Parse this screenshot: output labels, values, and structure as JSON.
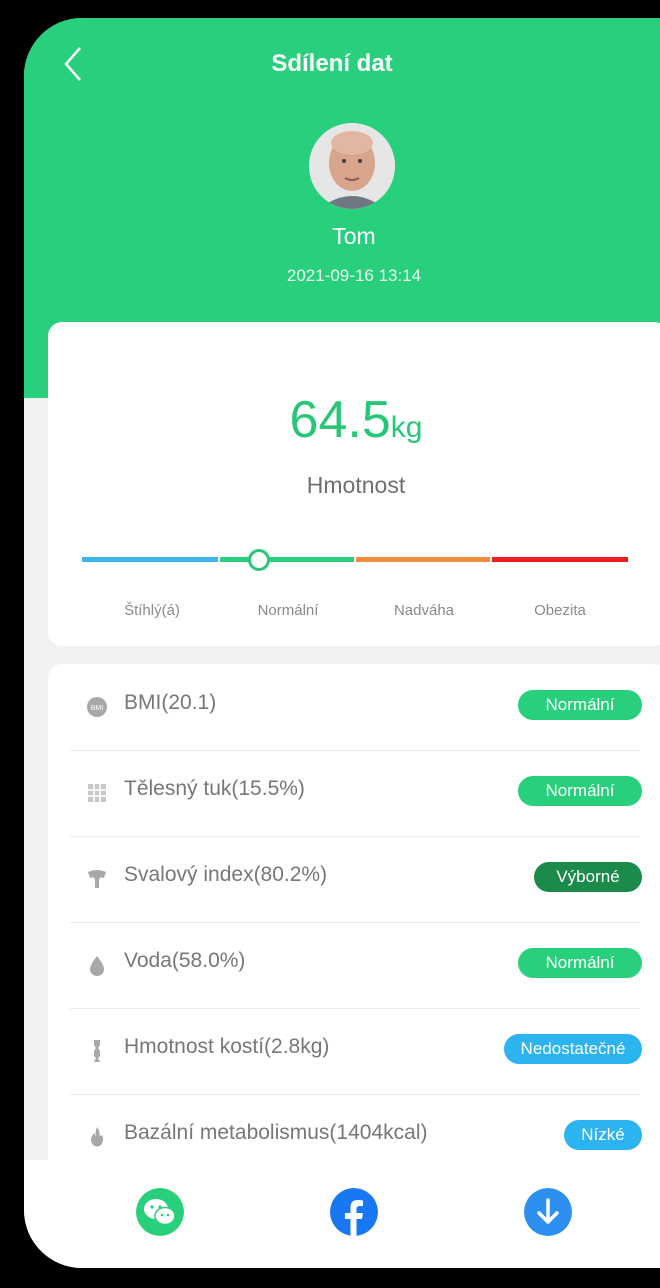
{
  "header": {
    "title": "Sdílení dat",
    "username": "Tom",
    "datetime": "2021-09-16 13:14"
  },
  "weight": {
    "value": "64.5",
    "unit": "kg",
    "label": "Hmotnost"
  },
  "scale": {
    "labels": [
      "Štíhlý(á)",
      "Normální",
      "Nadváha",
      "Obezita"
    ],
    "colors": [
      "#3db4ea",
      "#28cf7c",
      "#f0903c",
      "#ea2020"
    ]
  },
  "metrics": [
    {
      "label": "BMI(20.1)",
      "status": "Normální",
      "color": "#28cf7c",
      "icon": "bmi-icon"
    },
    {
      "label": "Tělesný tuk(15.5%)",
      "status": "Normální",
      "color": "#28cf7c",
      "icon": "body-fat-icon"
    },
    {
      "label": "Svalový index(80.2%)",
      "status": "Výborné",
      "color": "#1c8a4a",
      "icon": "muscle-icon"
    },
    {
      "label": "Voda(58.0%)",
      "status": "Normální",
      "color": "#28cf7c",
      "icon": "water-drop-icon"
    },
    {
      "label": "Hmotnost kostí(2.8kg)",
      "status": "Nedostatečné",
      "color": "#2cb4f0",
      "icon": "bone-icon"
    },
    {
      "label": "Bazální metabolismus(1404kcal)",
      "status": "Nízké",
      "color": "#2cb4f0",
      "icon": "flame-icon"
    }
  ],
  "share": [
    "wechat-icon",
    "facebook-icon",
    "download-icon"
  ]
}
